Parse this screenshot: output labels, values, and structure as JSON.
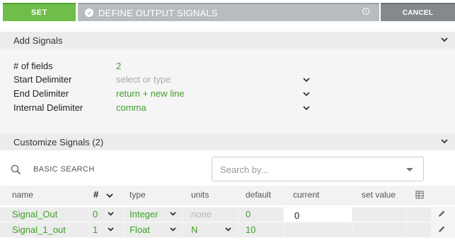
{
  "header": {
    "set_label": "SET",
    "title": "DEFINE OUTPUT SIGNALS",
    "info_glyph": "i",
    "cancel_label": "CANCEL",
    "set_color": "#6fbd4a",
    "title_bar_color": "#b9bcbe",
    "cancel_color": "#86898c"
  },
  "add_signals": {
    "heading": "Add Signals",
    "fields": [
      {
        "label": "# of fields",
        "value": "2",
        "has_dropdown": false
      },
      {
        "label": "Start Delimiter",
        "value": "select or type",
        "is_placeholder": true,
        "has_dropdown": true
      },
      {
        "label": "End Delimiter",
        "value": "return + new line",
        "has_dropdown": true
      },
      {
        "label": "Internal Delimiter",
        "value": "comma",
        "has_dropdown": true
      }
    ]
  },
  "customize_signals": {
    "heading": "Customize Signals (2)"
  },
  "search": {
    "basic_search_label": "BASIC SEARCH",
    "placeholder": "Search by..."
  },
  "table": {
    "columns": {
      "name": "name",
      "hash": "#",
      "type": "type",
      "units": "units",
      "default": "default",
      "current": "current",
      "set_value": "set value"
    },
    "rows": [
      {
        "name": "Signal_Out",
        "index": "0",
        "type": "Integer",
        "units": "none",
        "units_is_placeholder": true,
        "default": "0",
        "current": "0",
        "set_value": ""
      },
      {
        "name": "Signal_1_out",
        "index": "1",
        "type": "Float",
        "units": "N",
        "units_is_placeholder": false,
        "default": "10",
        "current": "",
        "set_value": ""
      }
    ]
  },
  "colors": {
    "accent_green": "#3ea02a",
    "placeholder_gray": "#aaaaaa"
  },
  "icons": [
    "check-circle-icon",
    "info-icon",
    "chevron-down-icon",
    "search-icon",
    "caret-down-icon",
    "column-settings-icon",
    "pencil-icon"
  ]
}
